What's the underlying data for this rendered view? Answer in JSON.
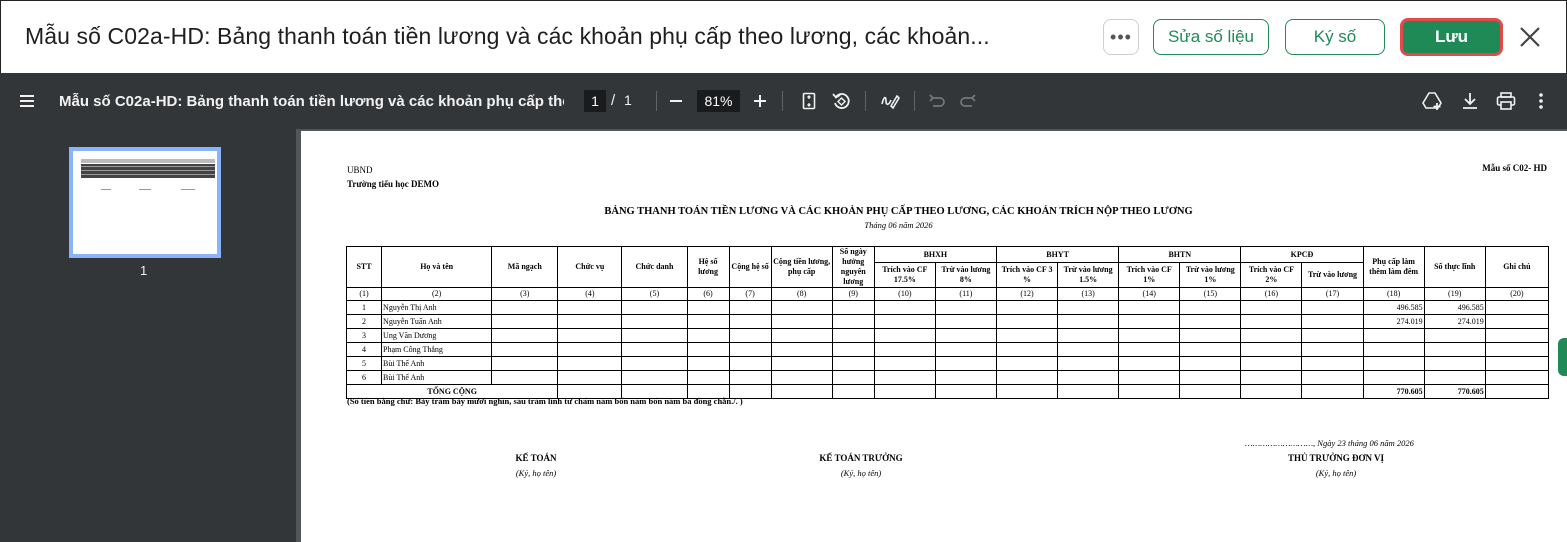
{
  "dialog": {
    "title": "Mẫu số C02a-HD: Bảng thanh toán tiền lương và các khoản phụ cấp theo lương, các khoản...",
    "more_label": "•••",
    "edit_label": "Sửa số liệu",
    "sign_label": "Ký số",
    "save_label": "Lưu",
    "accent_color": "#1f8a55"
  },
  "viewer": {
    "doc_title": "Mẫu số C02a-HD: Bảng thanh toán tiền lương và các khoản phụ cấp theo lươ...",
    "page_current": "1",
    "page_sep": "/",
    "page_total": "1",
    "zoom": "81%",
    "thumb_label": "1"
  },
  "doc": {
    "ubnd": "UBND",
    "school": "Trường tiểu học DEMO",
    "form_no": "Mẫu số C02- HD",
    "title": "BẢNG THANH TOÁN TIỀN LƯƠNG VÀ CÁC KHOẢN PHỤ CẤP THEO LƯƠNG, CÁC KHOẢN TRÍCH NỘP THEO LƯƠNG",
    "subtitle": "Tháng 06 năm 2026",
    "headers": {
      "stt": "STT",
      "name": "Họ và tên",
      "ma_ngach": "Mã ngạch",
      "chuc_vu": "Chức vụ",
      "chuc_danh": "Chức danh",
      "he_so_luong": "Hệ số lương",
      "cong_he_so": "Cộng hệ số",
      "cong_tien": "Cộng tiền lương, phụ cấp",
      "so_ngay": "Số ngày hưởng nguyên lương",
      "bhxh": "BHXH",
      "bhyt": "BHYT",
      "bhtn": "BHTN",
      "kpcd": "KPCĐ",
      "phu_cap": "Phụ cấp làm thêm làm đêm",
      "so_thuc_linh": "Số thực lĩnh",
      "ghi_chu": "Ghi chú",
      "bhxh_cf": "Trích vào CF 17.5%",
      "bhxh_luong": "Trừ vào lương 8%",
      "bhyt_cf": "Trích vào CF 3 %",
      "bhyt_luong": "Trừ vào lương 1.5%",
      "bhtn_cf": "Trích vào CF 1%",
      "bhtn_luong": "Trừ vào lương 1%",
      "kpcd_cf": "Trích vào CF 2%",
      "kpcd_luong": "Trừ vào lương"
    },
    "col_numbers": [
      "(1)",
      "(2)",
      "(3)",
      "(4)",
      "(5)",
      "(6)",
      "(7)",
      "(8)",
      "(9)",
      "(10)",
      "(11)",
      "(12)",
      "(13)",
      "(14)",
      "(15)",
      "(16)",
      "(17)",
      "(18)",
      "(19)",
      "(20)"
    ],
    "rows": [
      {
        "stt": "1",
        "name": "Nguyễn Thị Anh",
        "phu_cap": "496.585",
        "thuc_linh": "496.585"
      },
      {
        "stt": "2",
        "name": "Nguyễn Tuấn Anh",
        "phu_cap": "274.019",
        "thuc_linh": "274.019"
      },
      {
        "stt": "3",
        "name": "Ung Văn Dương",
        "phu_cap": "",
        "thuc_linh": ""
      },
      {
        "stt": "4",
        "name": "Phạm Công Thắng",
        "phu_cap": "",
        "thuc_linh": ""
      },
      {
        "stt": "5",
        "name": "Bùi Thế Anh",
        "phu_cap": "",
        "thuc_linh": ""
      },
      {
        "stt": "6",
        "name": "Bùi Thế Anh",
        "phu_cap": "",
        "thuc_linh": ""
      }
    ],
    "total_label": "TỔNG CỘNG",
    "total_phu_cap": "770.605",
    "total_thuc_linh": "770.605",
    "amount_in_words": "(Số tiền bằng chữ: Bảy trăm bảy mươi nghìn, sáu trăm linh tư chấm năm bốn năm bốn năm ba đồng chẵn./. )",
    "date_line": "………………………, Ngày 23 tháng 06 năm 2026",
    "signatures": [
      {
        "title": "KẾ TOÁN",
        "sub": "(Ký, họ tên)"
      },
      {
        "title": "KẾ TOÁN TRƯỞNG",
        "sub": "(Ký, họ tên)"
      },
      {
        "title": "THỦ TRƯỞNG ĐƠN VỊ",
        "sub": "(Ký, họ tên)"
      }
    ]
  }
}
